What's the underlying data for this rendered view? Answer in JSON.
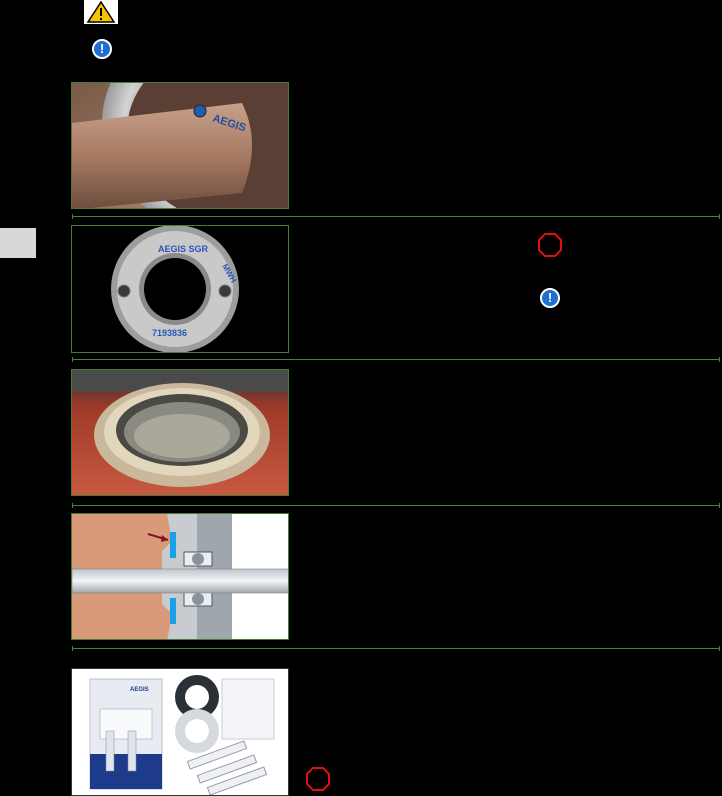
{
  "icons": {
    "warning": "warning-triangle-icon",
    "info": "info-exclamation-icon",
    "stop": "stop-octagon-icon"
  },
  "colors": {
    "background": "#000000",
    "divider": "#3c8a3c",
    "info_blue": "#1e6fd0",
    "stop_red": "#e11010",
    "warning_yellow": "#f5c400",
    "tab_gray": "#d8d8d8"
  },
  "glyphs": {
    "info": "!",
    "warning": "!"
  },
  "images": [
    {
      "name": "ring-installed-on-shaft-photo",
      "brand": "AEGIS"
    },
    {
      "name": "split-ring-top-view-photo",
      "ring_text": "AEGIS SGR",
      "ring_text_2": "7193836",
      "ring_text_3": "MWH"
    },
    {
      "name": "ring-mounted-in-housing-photo"
    },
    {
      "name": "cross-section-diagram"
    },
    {
      "name": "installation-kit-photo",
      "brand": "AEGIS"
    }
  ]
}
